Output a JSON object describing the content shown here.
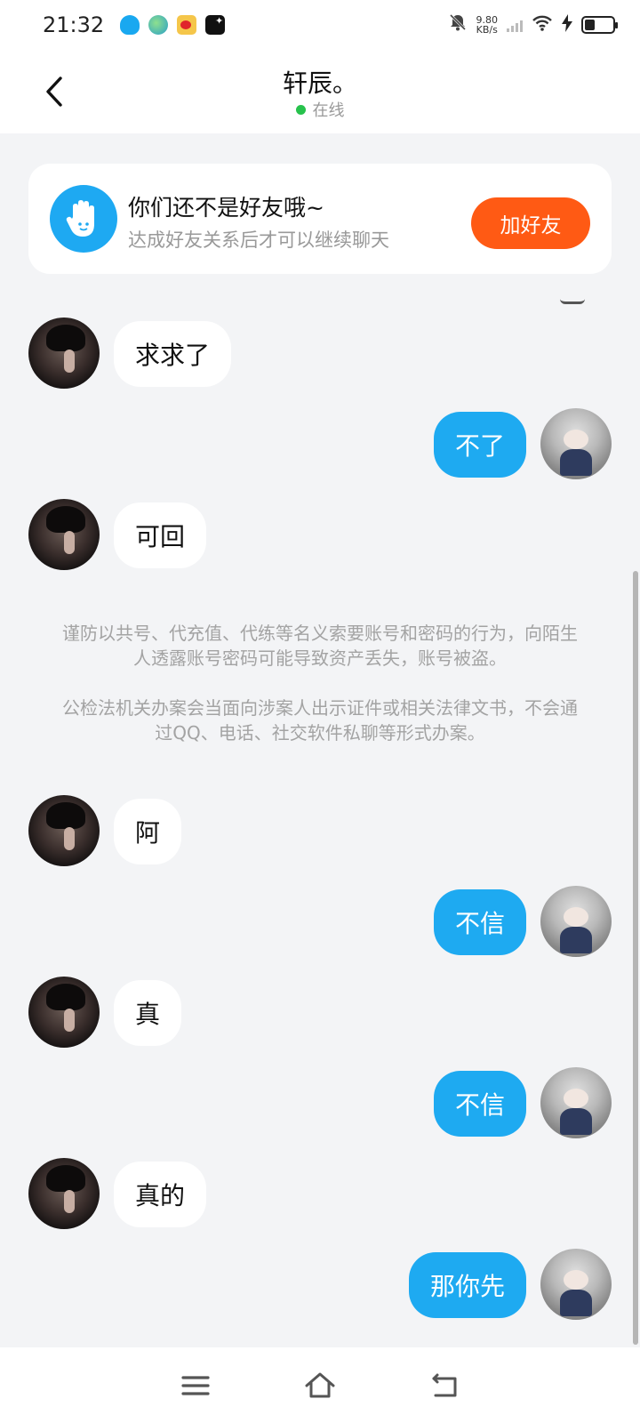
{
  "status_bar": {
    "time": "21:32",
    "net_speed_value": "9.80",
    "net_speed_unit": "KB/s",
    "app_icons": [
      "qq-icon",
      "browser-icon",
      "weibo-icon",
      "star-app-icon"
    ],
    "battery_level": 0.35
  },
  "header": {
    "title": "轩辰。",
    "status": "在线"
  },
  "friend_card": {
    "title": "你们还不是好友哦~",
    "subtitle": "达成好友关系后才可以继续聊天",
    "button": "加好友"
  },
  "messages": [
    {
      "side": "them",
      "text": "求求了"
    },
    {
      "side": "me",
      "text": "不了"
    },
    {
      "side": "them",
      "text": "可回"
    },
    {
      "side": "them",
      "text": "阿"
    },
    {
      "side": "me",
      "text": "不信"
    },
    {
      "side": "them",
      "text": "真"
    },
    {
      "side": "me",
      "text": "不信"
    },
    {
      "side": "them",
      "text": "真的"
    },
    {
      "side": "me",
      "text": "那你先"
    }
  ],
  "notice": {
    "paragraph1": "谨防以共号、代充值、代练等名义索要账号和密码的行为，向陌生人透露账号密码可能导致资产丢失，账号被盗。",
    "paragraph2": "公检法机关办案会当面向涉案人出示证件或相关法律文书，不会通过QQ、电话、社交软件私聊等形式办案。"
  },
  "colors": {
    "accent": "#1eaaf1",
    "add_button": "#ff5a14",
    "online_dot": "#27c24c",
    "background": "#f3f4f6"
  }
}
